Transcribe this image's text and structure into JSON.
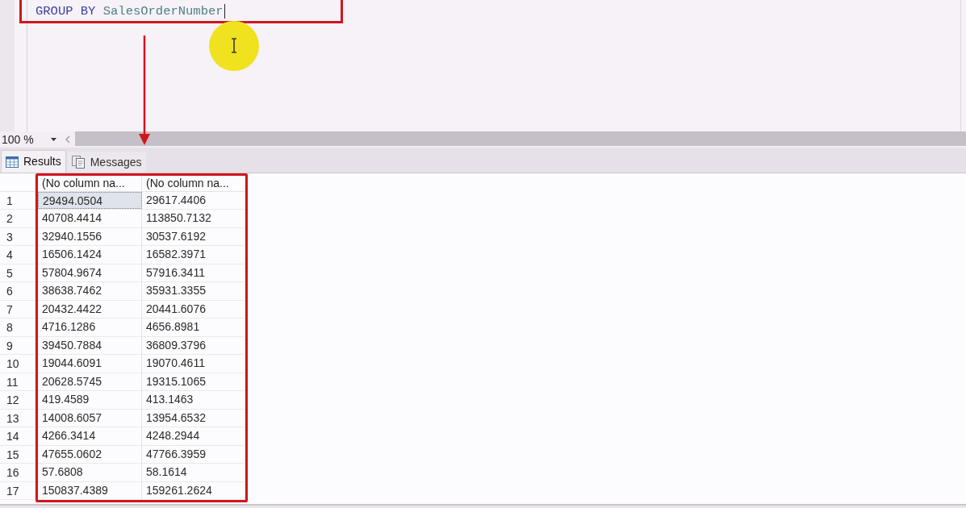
{
  "editor": {
    "code_line": [
      {
        "kind": "keyword",
        "text": "GROUP BY"
      },
      {
        "kind": "identifier",
        "text": "SalesOrderNumber"
      }
    ]
  },
  "zoom": {
    "value": "100 %"
  },
  "tabs": [
    {
      "kind": "results",
      "label": "Results",
      "selected": true
    },
    {
      "kind": "messages",
      "label": "Messages",
      "selected": false
    }
  ],
  "grid": {
    "columns": [
      "(No column na...",
      "(No column na..."
    ],
    "rows": [
      {
        "number": "1",
        "cells": [
          {
            "value": "29494.0504",
            "selected": true
          },
          {
            "value": "29617.4406",
            "selected": false
          }
        ]
      },
      {
        "number": "2",
        "cells": [
          {
            "value": "40708.4414",
            "selected": false
          },
          {
            "value": "113850.7132",
            "selected": false
          }
        ]
      },
      {
        "number": "3",
        "cells": [
          {
            "value": "32940.1556",
            "selected": false
          },
          {
            "value": "30537.6192",
            "selected": false
          }
        ]
      },
      {
        "number": "4",
        "cells": [
          {
            "value": "16506.1424",
            "selected": false
          },
          {
            "value": "16582.3971",
            "selected": false
          }
        ]
      },
      {
        "number": "5",
        "cells": [
          {
            "value": "57804.9674",
            "selected": false
          },
          {
            "value": "57916.3411",
            "selected": false
          }
        ]
      },
      {
        "number": "6",
        "cells": [
          {
            "value": "38638.7462",
            "selected": false
          },
          {
            "value": "35931.3355",
            "selected": false
          }
        ]
      },
      {
        "number": "7",
        "cells": [
          {
            "value": "20432.4422",
            "selected": false
          },
          {
            "value": "20441.6076",
            "selected": false
          }
        ]
      },
      {
        "number": "8",
        "cells": [
          {
            "value": "4716.1286",
            "selected": false
          },
          {
            "value": "4656.8981",
            "selected": false
          }
        ]
      },
      {
        "number": "9",
        "cells": [
          {
            "value": "39450.7884",
            "selected": false
          },
          {
            "value": "36809.3796",
            "selected": false
          }
        ]
      },
      {
        "number": "10",
        "cells": [
          {
            "value": "19044.6091",
            "selected": false
          },
          {
            "value": "19070.4611",
            "selected": false
          }
        ]
      },
      {
        "number": "11",
        "cells": [
          {
            "value": "20628.5745",
            "selected": false
          },
          {
            "value": "19315.1065",
            "selected": false
          }
        ]
      },
      {
        "number": "12",
        "cells": [
          {
            "value": "419.4589",
            "selected": false
          },
          {
            "value": "413.1463",
            "selected": false
          }
        ]
      },
      {
        "number": "13",
        "cells": [
          {
            "value": "14008.6057",
            "selected": false
          },
          {
            "value": "13954.6532",
            "selected": false
          }
        ]
      },
      {
        "number": "14",
        "cells": [
          {
            "value": "4266.3414",
            "selected": false
          },
          {
            "value": "4248.2944",
            "selected": false
          }
        ]
      },
      {
        "number": "15",
        "cells": [
          {
            "value": "47655.0602",
            "selected": false
          },
          {
            "value": "47766.3959",
            "selected": false
          }
        ]
      },
      {
        "number": "16",
        "cells": [
          {
            "value": "57.6808",
            "selected": false
          },
          {
            "value": "58.1614",
            "selected": false
          }
        ]
      },
      {
        "number": "17",
        "cells": [
          {
            "value": "150837.4389",
            "selected": false
          },
          {
            "value": "159261.2624",
            "selected": false
          }
        ]
      }
    ]
  }
}
